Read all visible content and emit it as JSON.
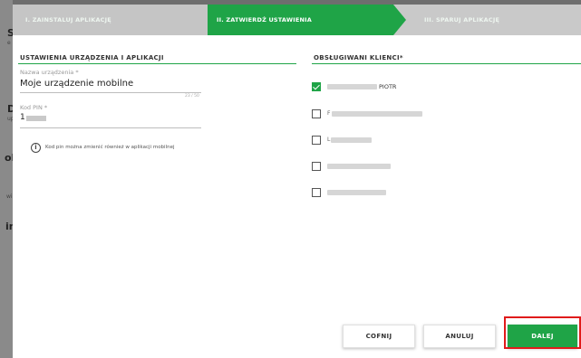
{
  "background": {
    "letters": [
      "S",
      "D",
      "ol",
      "wi",
      "in"
    ],
    "small": [
      "e",
      "up"
    ]
  },
  "steps": [
    {
      "label": "I. ZAINSTALUJ APLIKACJĘ"
    },
    {
      "label": "II. ZATWIERDŹ USTAWIENIA"
    },
    {
      "label": "III. SPARUJ APLIKACJĘ"
    }
  ],
  "device": {
    "section_title": "USTAWIENIA URZĄDZENIA I APLIKACJI",
    "name_label": "Nazwa urządzenia *",
    "name_value": "Moje urządzenie mobilne",
    "name_counter": "23 / 50",
    "pin_label": "Kod PIN *",
    "pin_value_prefix": "1",
    "info_icon": "info-icon",
    "info_text": "Kod pin można zmienić również w aplikacji mobilnej"
  },
  "clients": {
    "section_title": "OBSŁUGIWANI KLIENCI*",
    "items": [
      {
        "checked": true,
        "visible_text": "PIOTR"
      },
      {
        "checked": false,
        "visible_text": "F"
      },
      {
        "checked": false,
        "visible_text": "L"
      },
      {
        "checked": false,
        "visible_text": ""
      },
      {
        "checked": false,
        "visible_text": ""
      }
    ]
  },
  "footer": {
    "back_label": "COFNIJ",
    "cancel_label": "ANULUJ",
    "next_label": "DALEJ"
  },
  "colors": {
    "accent": "#1fa447",
    "highlight": "#e01b1b"
  }
}
